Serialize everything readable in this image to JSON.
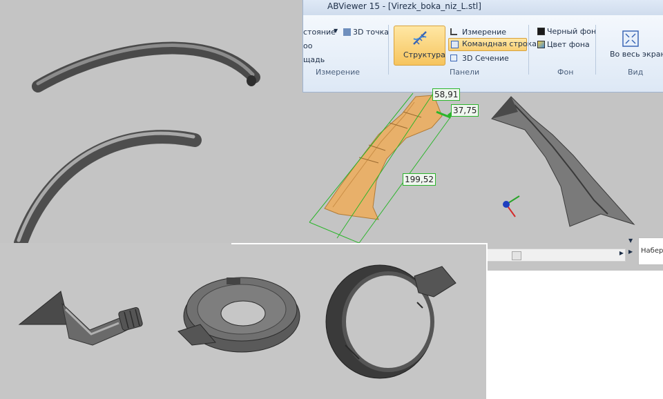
{
  "window": {
    "title": "ABViewer 15 - [Virezk_boka_niz_L.stl]"
  },
  "ribbon": {
    "measure_group": {
      "items": [
        "стояние",
        "3D точка",
        "оо",
        "щадь"
      ],
      "label": "Измерение"
    },
    "panels_group": {
      "big_button": "Структура",
      "items": [
        "Измерение",
        "Командная строка",
        "3D Сечение"
      ],
      "label": "Панели"
    },
    "background_group": {
      "items": [
        "Черный фон",
        "Цвет фона"
      ],
      "label": "Фон"
    },
    "view_group": {
      "button": "Во весь экран",
      "label": "Вид"
    }
  },
  "dimensions": [
    "58,91",
    "37,75",
    "199,52"
  ],
  "search": {
    "placeholder": "Набери"
  },
  "colors": {
    "part": "#e8b06a",
    "dim_green": "#2bb52b",
    "ribbon_bg": "#e6eef8",
    "selected": "#f8cf74"
  }
}
